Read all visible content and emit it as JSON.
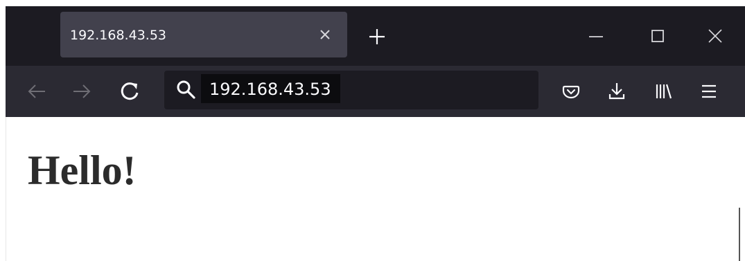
{
  "browser": {
    "tab": {
      "title": "192.168.43.53"
    },
    "address_bar": {
      "value": "192.168.43.53"
    },
    "icons": {
      "tab_close": "close-icon",
      "new_tab": "plus-icon",
      "minimize": "minimize-icon",
      "maximize": "maximize-icon",
      "close": "close-icon",
      "back": "arrow-left-icon",
      "forward": "arrow-right-icon",
      "reload": "reload-icon",
      "search": "search-icon",
      "pocket": "pocket-icon",
      "downloads": "download-icon",
      "library": "library-icon",
      "menu": "hamburger-menu-icon"
    },
    "colors": {
      "tabstrip": "#1c1b22",
      "active_tab": "#42414d",
      "toolbar": "#2b2a33",
      "urlbar": "#1c1b22"
    }
  },
  "page": {
    "heading": "Hello!"
  }
}
